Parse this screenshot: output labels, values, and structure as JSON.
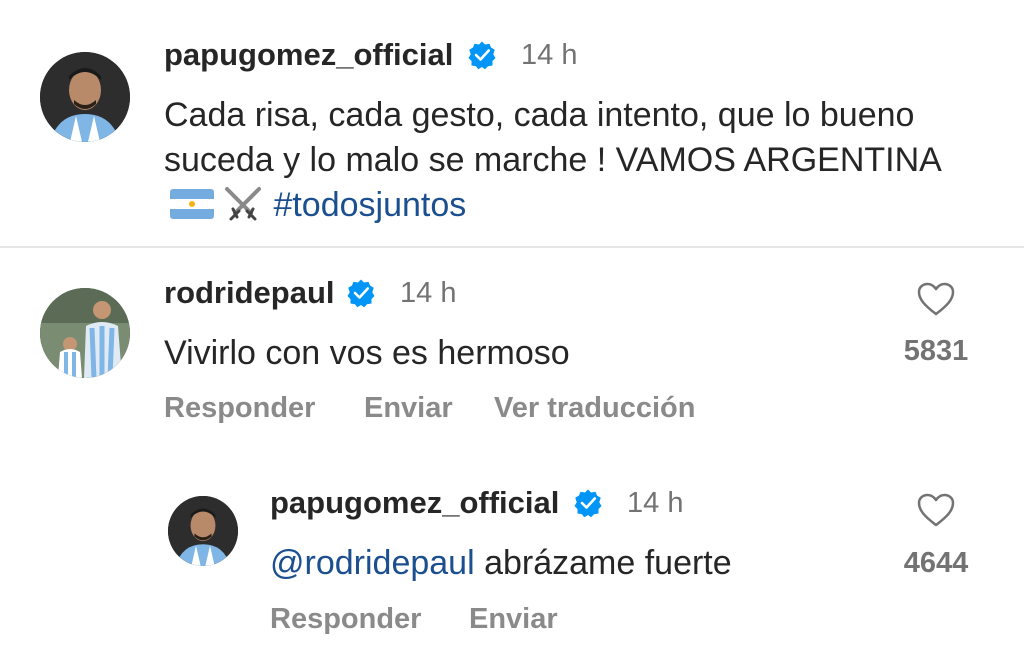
{
  "post": {
    "username": "papugomez_official",
    "time": "14 h",
    "text_plain": "Cada risa, cada gesto, cada intento, que lo bueno suceda y lo malo se marche ! VAMOS ARGENTINA",
    "hashtag": "#todosjuntos",
    "emoji": [
      "argentina-flag-icon",
      "crossed-swords-icon"
    ]
  },
  "comment": {
    "username": "rodridepaul",
    "time": "14 h",
    "text": "Vivirlo con vos es hermoso",
    "likes": "5831",
    "actions": [
      "Responder",
      "Enviar",
      "Ver traducción"
    ]
  },
  "reply": {
    "username": "papugomez_official",
    "time": "14 h",
    "mention": "@rodridepaul",
    "text": " abrázame fuerte",
    "likes": "4644",
    "actions": [
      "Responder",
      "Enviar"
    ]
  },
  "colors": {
    "verified": "#0095f6",
    "link": "#1b4f8f",
    "secondary": "#737373"
  }
}
